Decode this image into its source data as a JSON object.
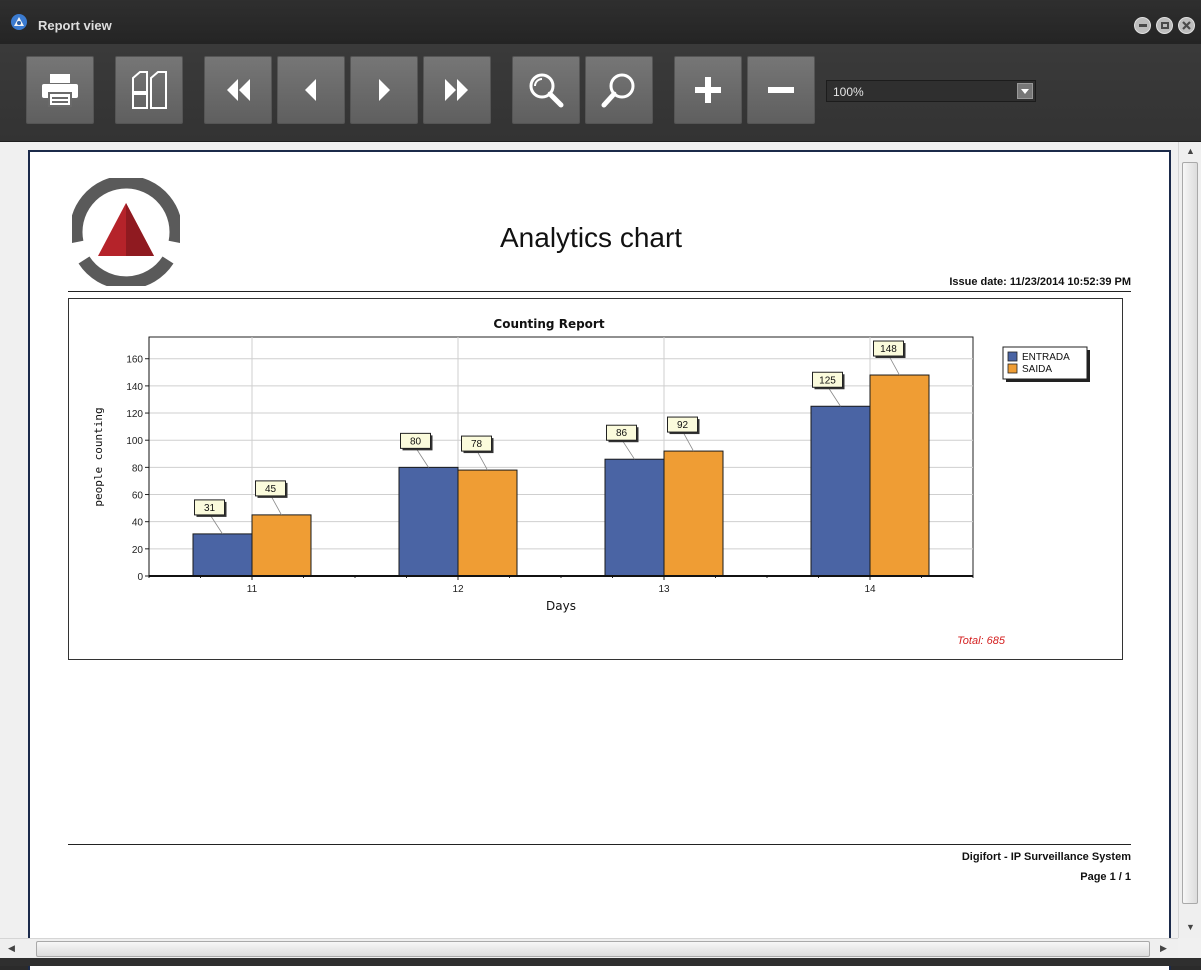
{
  "window": {
    "title": "Report view",
    "controls": [
      "minimize",
      "maximize",
      "close"
    ]
  },
  "toolbar": {
    "buttons": [
      {
        "name": "print",
        "icon": "printer-icon"
      },
      {
        "name": "page-setup",
        "icon": "pages-icon"
      },
      {
        "name": "first-page",
        "icon": "double-left-arrow-icon"
      },
      {
        "name": "previous-page",
        "icon": "left-arrow-icon"
      },
      {
        "name": "next-page",
        "icon": "right-arrow-icon"
      },
      {
        "name": "last-page",
        "icon": "double-right-arrow-icon"
      },
      {
        "name": "zoom-in",
        "icon": "magnifier-icon"
      },
      {
        "name": "zoom-out",
        "icon": "magnifier-alt-icon"
      },
      {
        "name": "increase",
        "icon": "plus-icon"
      },
      {
        "name": "decrease",
        "icon": "minus-icon"
      }
    ],
    "zoom_value": "100%"
  },
  "report": {
    "title": "Analytics chart",
    "issue_date": "Issue date: 11/23/2014 10:52:39 PM",
    "total": "Total: 685",
    "footer_company": "Digifort - IP Surveillance System",
    "footer_page": "Page 1 / 1"
  },
  "chart_data": {
    "type": "bar",
    "title": "Counting Report",
    "xlabel": "Days",
    "ylabel": "people counting",
    "categories": [
      "11",
      "12",
      "13",
      "14"
    ],
    "series": [
      {
        "name": "ENTRADA",
        "color": "#4a64a4",
        "values": [
          31,
          80,
          86,
          125
        ]
      },
      {
        "name": "SAIDA",
        "color": "#ef9d34",
        "values": [
          45,
          78,
          92,
          148
        ]
      }
    ],
    "ylim": [
      0,
      176
    ],
    "yticks": [
      0,
      20,
      40,
      60,
      80,
      100,
      120,
      140,
      160
    ],
    "grid": true,
    "legend": "top-right",
    "data_labels": true
  },
  "colors": {
    "logo_red": "#b5232a",
    "logo_gray": "#5a5a5a",
    "total_red": "#d42020",
    "page_border": "#1b2a4a"
  }
}
